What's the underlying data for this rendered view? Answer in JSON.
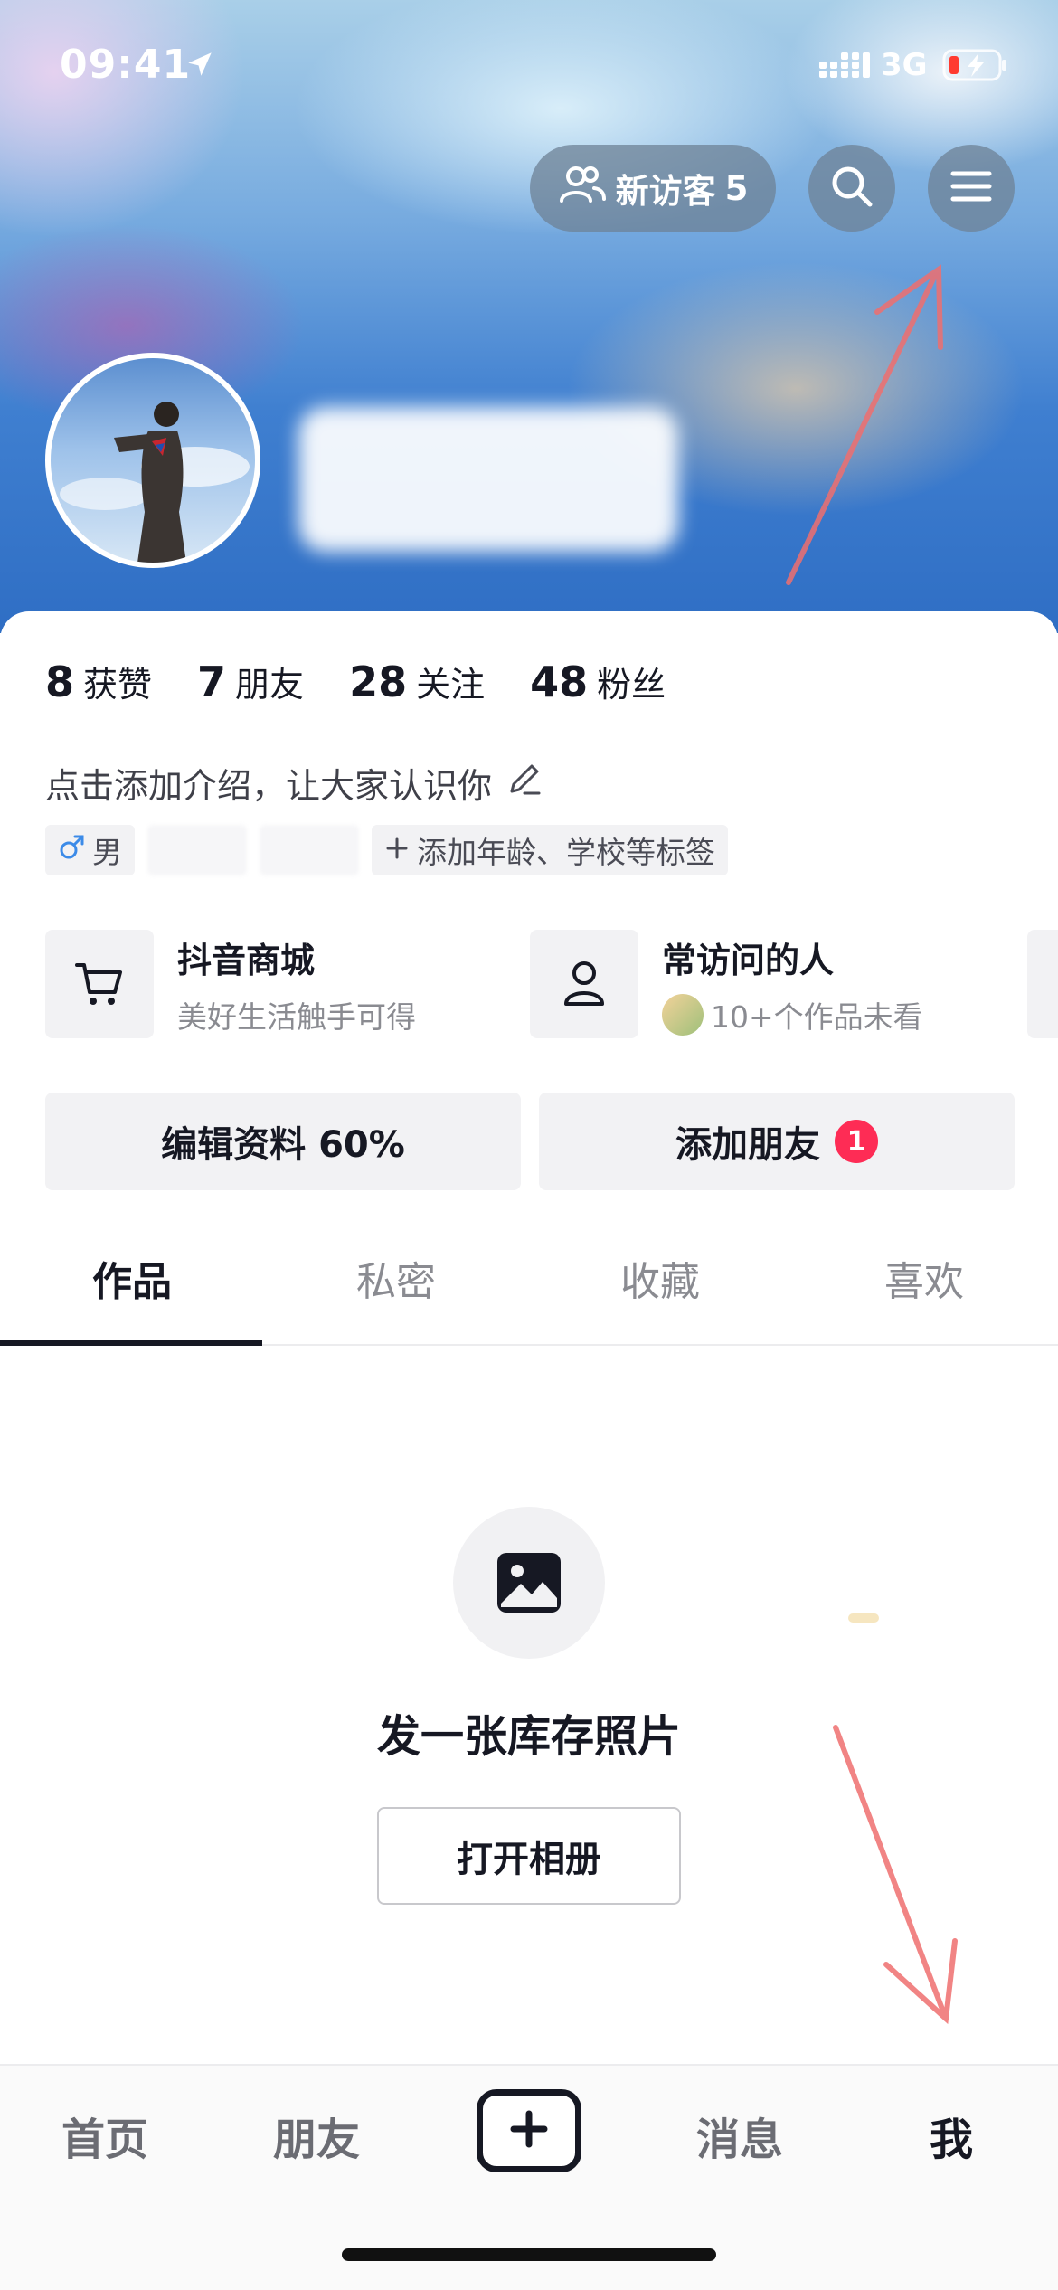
{
  "status_bar": {
    "time": "09:41",
    "network": "3G"
  },
  "header": {
    "visitors_label": "新访客",
    "visitors_count": "5",
    "search_icon": "search-icon",
    "menu_icon": "menu-icon"
  },
  "profile": {
    "avatar": "avatar",
    "stats": [
      {
        "num": "8",
        "label": "获赞"
      },
      {
        "num": "7",
        "label": "朋友"
      },
      {
        "num": "28",
        "label": "关注"
      },
      {
        "num": "48",
        "label": "粉丝"
      }
    ],
    "bio_placeholder": "点击添加介绍，让大家认识你",
    "tags": {
      "gender": "男",
      "add_tags": "添加年龄、学校等标签"
    }
  },
  "cards": [
    {
      "title": "抖音商城",
      "subtitle": "美好生活触手可得",
      "icon": "cart-icon"
    },
    {
      "title": "常访问的人",
      "subtitle": "10+个作品未看",
      "icon": "person-icon"
    }
  ],
  "actions": {
    "edit_profile": "编辑资料 60%",
    "add_friends": "添加朋友",
    "add_friends_badge": "1"
  },
  "tabs": [
    "作品",
    "私密",
    "收藏",
    "喜欢"
  ],
  "empty_state": {
    "icon": "image-icon",
    "title": "发一张库存照片",
    "button": "打开相册"
  },
  "bottom_nav": {
    "home": "首页",
    "friends": "朋友",
    "add_icon": "plus-icon",
    "messages": "消息",
    "me": "我"
  },
  "colors": {
    "accent": "#fe2c55",
    "text_primary": "#161823",
    "text_secondary": "#8a8b91",
    "annotation_arrow": "#ef6f6f"
  }
}
